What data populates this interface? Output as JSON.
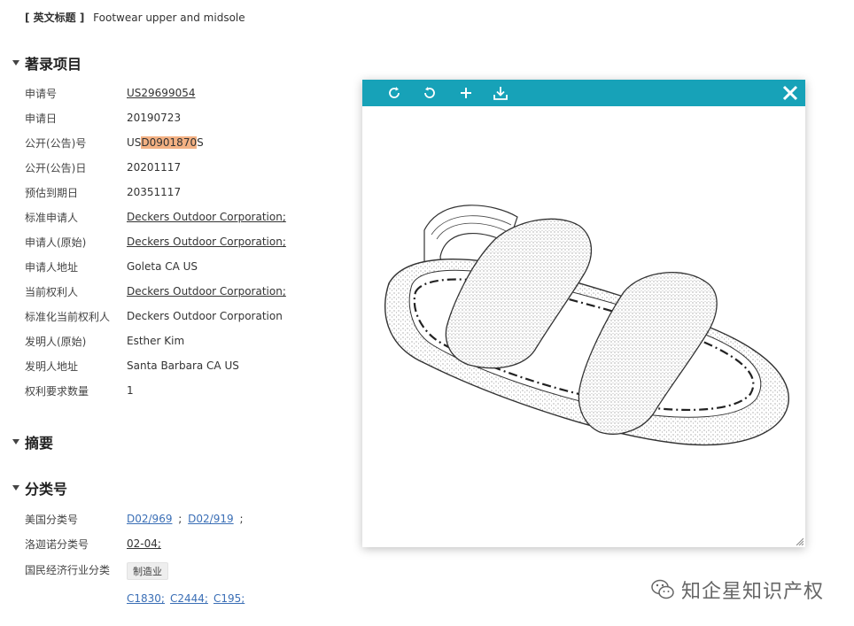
{
  "english_title": {
    "label": "[ 英文标题 ]",
    "value": "Footwear upper and midsole"
  },
  "sections": {
    "bibliographic": "著录项目",
    "abstract": "摘要",
    "classification": "分类号"
  },
  "biblio_rows": [
    {
      "label": "申请号",
      "value": "US29699054"
    },
    {
      "label": "申请日",
      "value": "20190723"
    },
    {
      "label": "公开(公告)号",
      "value_prefix": "US",
      "value_highlight": "D0901870",
      "value_suffix": "S"
    },
    {
      "label": "公开(公告)日",
      "value": "20201117"
    },
    {
      "label": "预估到期日",
      "value": "20351117"
    },
    {
      "label": "标准申请人",
      "value": "Deckers Outdoor Corporation;"
    },
    {
      "label": "申请人(原始)",
      "value": "Deckers Outdoor Corporation;"
    },
    {
      "label": "申请人地址",
      "value": "Goleta CA US"
    },
    {
      "label": "当前权利人",
      "value": "Deckers Outdoor Corporation;"
    },
    {
      "label": "标准化当前权利人",
      "value": "Deckers Outdoor Corporation"
    },
    {
      "label": "发明人(原始)",
      "value": "Esther Kim"
    },
    {
      "label": "发明人地址",
      "value": "Santa Barbara CA US"
    },
    {
      "label": "权利要求数量",
      "value": "1"
    }
  ],
  "classification_rows": {
    "us": {
      "label": "美国分类号",
      "link1": "D02/969",
      "sep1": ";",
      "link2": "D02/919",
      "sep2": ";"
    },
    "locarno": {
      "label": "洛迦诺分类号",
      "link1": "02-04;"
    },
    "industry": {
      "label": "国民经济行业分类",
      "tag": "制造业",
      "codes": [
        "C1830;",
        "C2444;",
        "C195;"
      ]
    }
  },
  "viewer": {
    "tools": [
      "rotate-right-icon",
      "rotate-left-icon",
      "zoom-in-icon",
      "download-icon"
    ],
    "accent": "#17a2b8"
  },
  "watermark": {
    "text": "知企星知识产权"
  }
}
